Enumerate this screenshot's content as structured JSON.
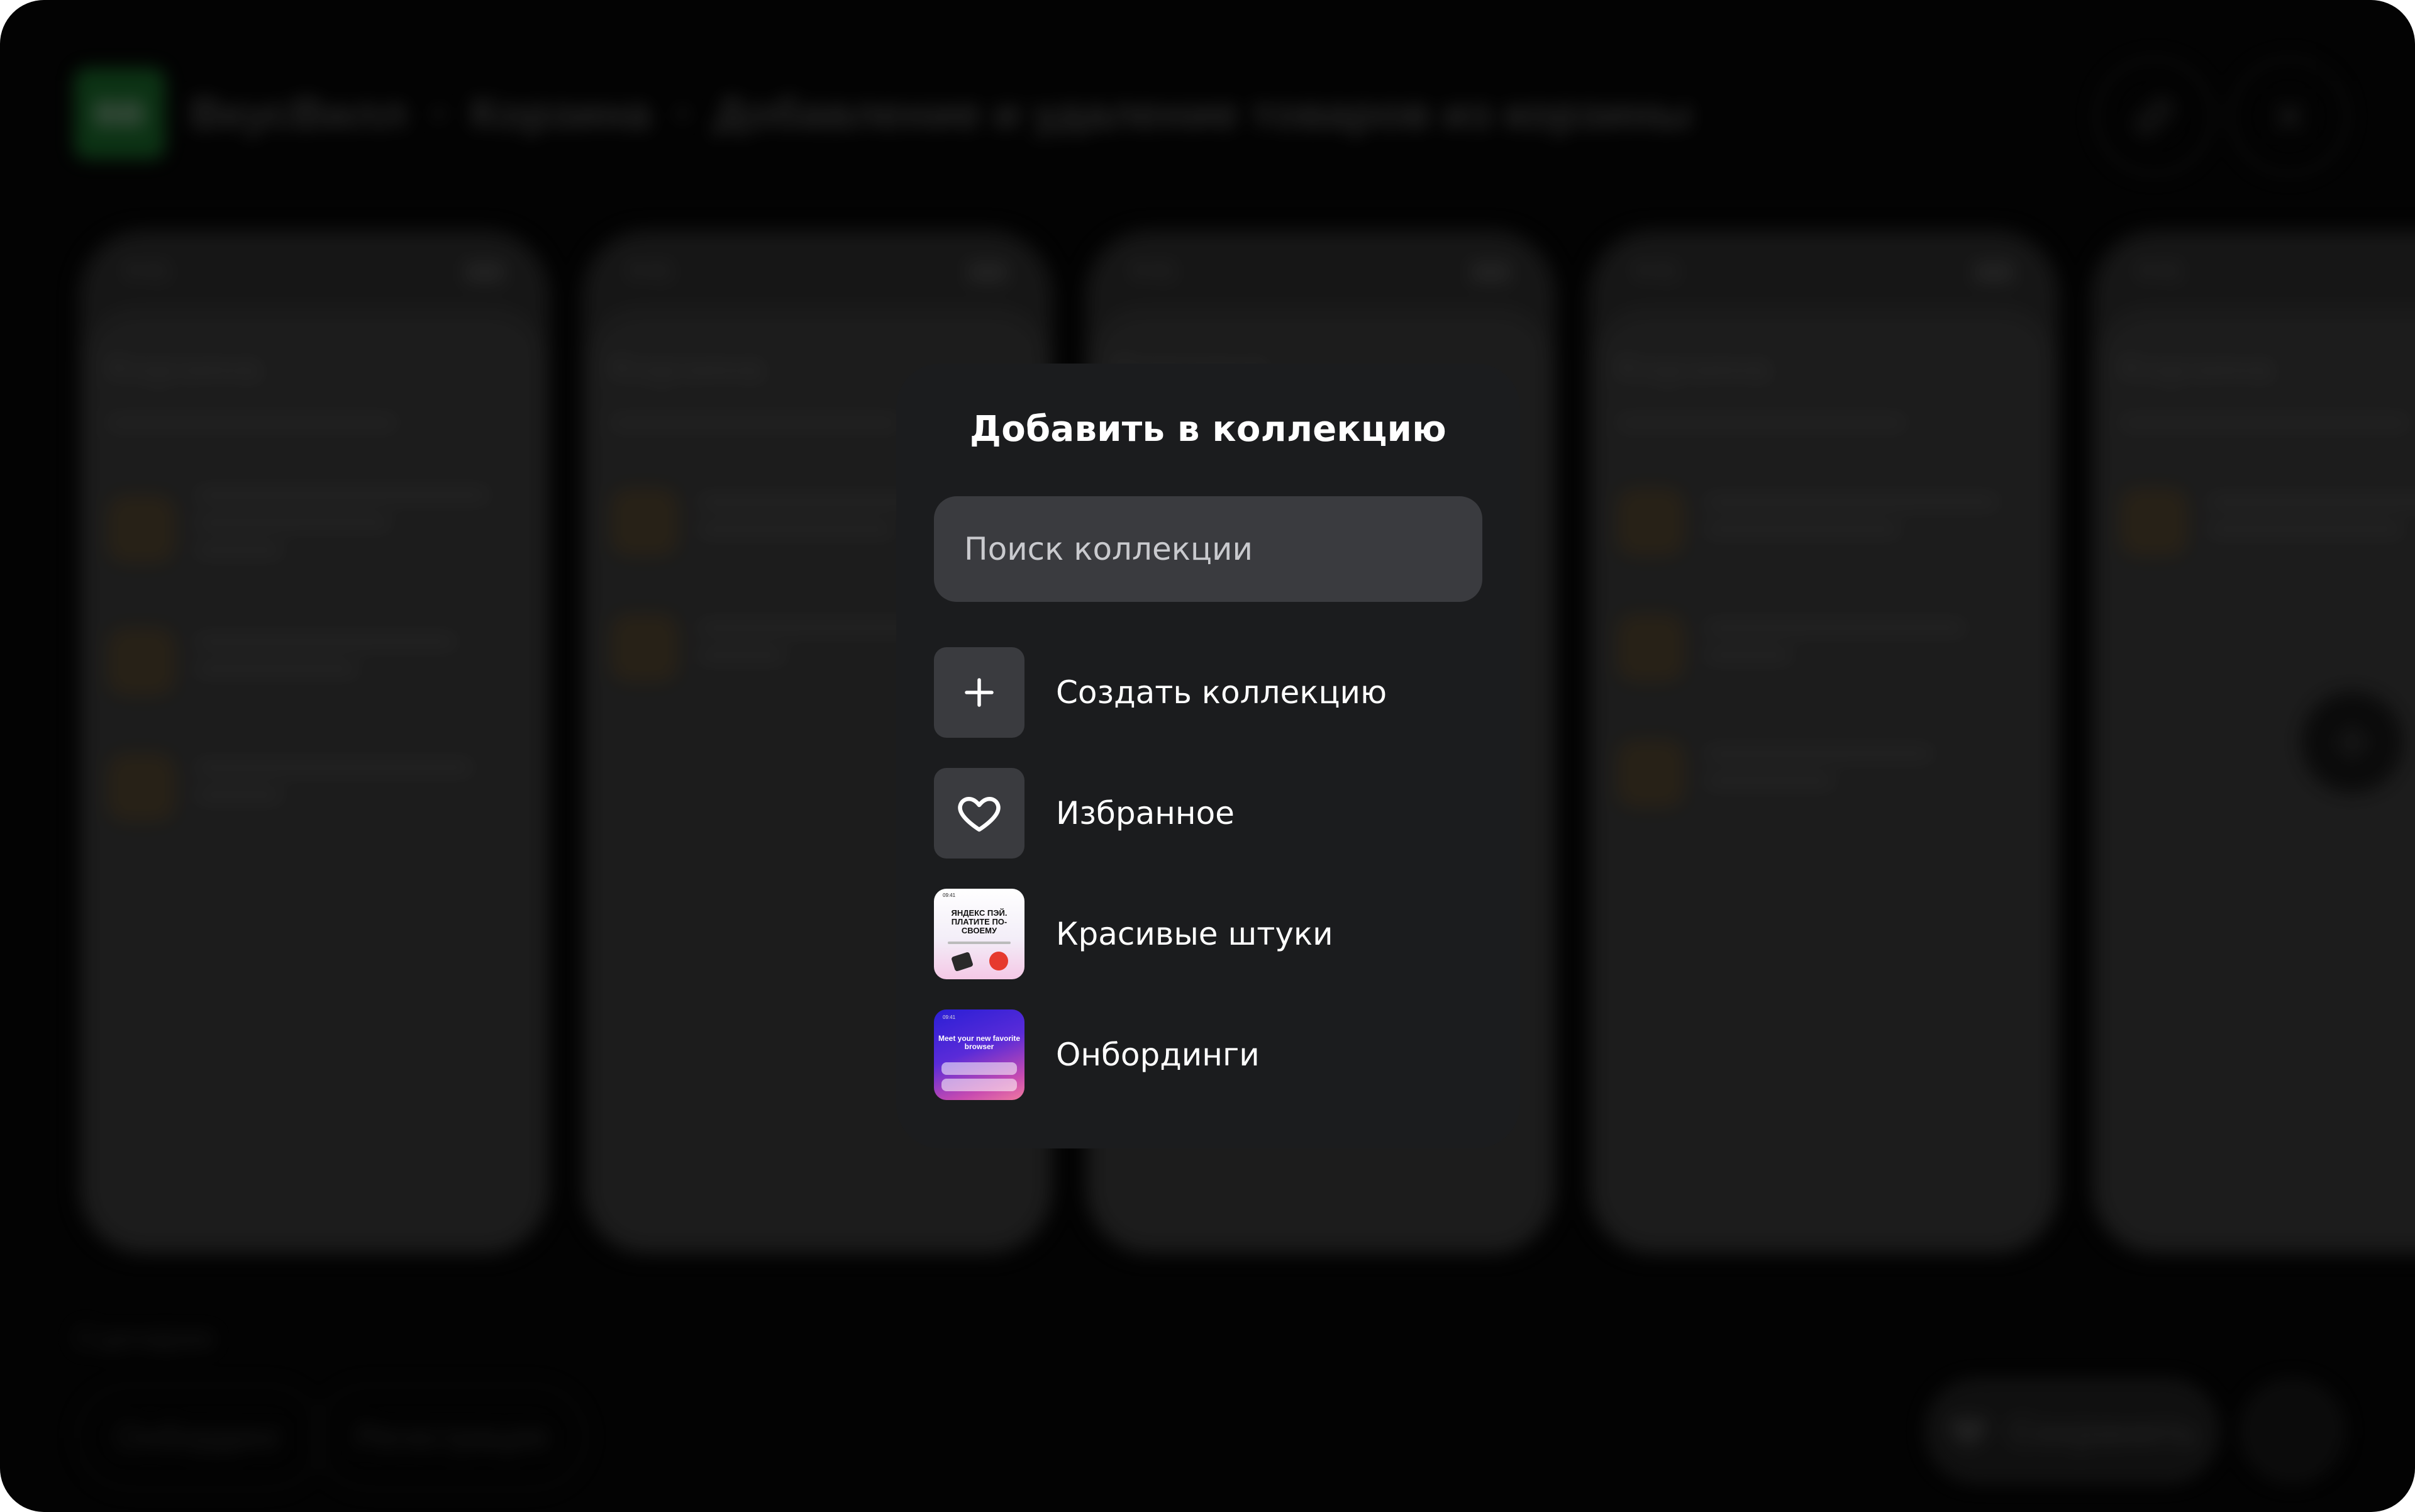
{
  "background": {
    "app_name": "ВкусВилл",
    "logo_text": "ВВ",
    "breadcrumb": [
      "ВкусВилл",
      "Корзина",
      "Добавление и удаление товаров из корзины"
    ],
    "breadcrumb_sep": "•",
    "phone_title": "Корзина",
    "section_label": "Сценарии",
    "chips": [
      "Онбординг",
      "Регистрация"
    ],
    "save_label": "Сохранить"
  },
  "modal": {
    "title": "Добавить в коллекцию",
    "search_placeholder": "Поиск коллекции",
    "items": [
      {
        "label": "Создать коллекцию",
        "icon": "plus-icon"
      },
      {
        "label": "Избранное",
        "icon": "heart-icon"
      },
      {
        "label": "Красивые штуки",
        "icon": "thumbnail-yandex"
      },
      {
        "label": "Онбординги",
        "icon": "thumbnail-onboarding"
      }
    ],
    "thumb_yandex": {
      "time": "09:41",
      "headline": "ЯНДЕКС ПЭЙ. ПЛАТИТЕ ПО-СВОЕМУ"
    },
    "thumb_onboarding": {
      "time": "09:41",
      "headline": "Meet your new favorite browser"
    }
  },
  "colors": {
    "modal_bg": "#1b1c1e",
    "field_bg": "#3a3b3f",
    "text": "#ffffff",
    "placeholder": "#c9cace",
    "backdrop": "#050505"
  }
}
